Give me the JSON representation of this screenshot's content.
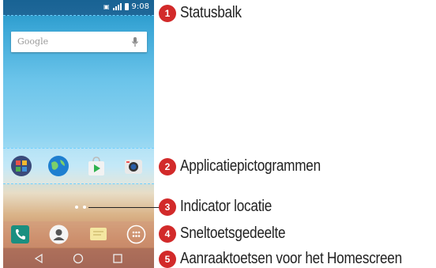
{
  "statusbar": {
    "time": "9:08"
  },
  "homescreen": {
    "search_placeholder": "Google",
    "app_icons": [
      "app-folder-icon",
      "browser-globe-icon",
      "play-store-icon",
      "camera-icon"
    ],
    "quick_keys": [
      "phone-icon",
      "contacts-icon",
      "messaging-icon",
      "apps-grid-icon"
    ],
    "nav_keys": [
      "back-icon",
      "home-icon",
      "recent-apps-icon"
    ]
  },
  "callouts": [
    {
      "number": "1",
      "label": "Statusbalk"
    },
    {
      "number": "2",
      "label": "Applicatiepictogrammen"
    },
    {
      "number": "3",
      "label": "Indicator locatie"
    },
    {
      "number": "4",
      "label": "Sneltoetsgedeelte"
    },
    {
      "number": "5",
      "label": "Aanraaktoetsen voor het Homescreen"
    }
  ]
}
